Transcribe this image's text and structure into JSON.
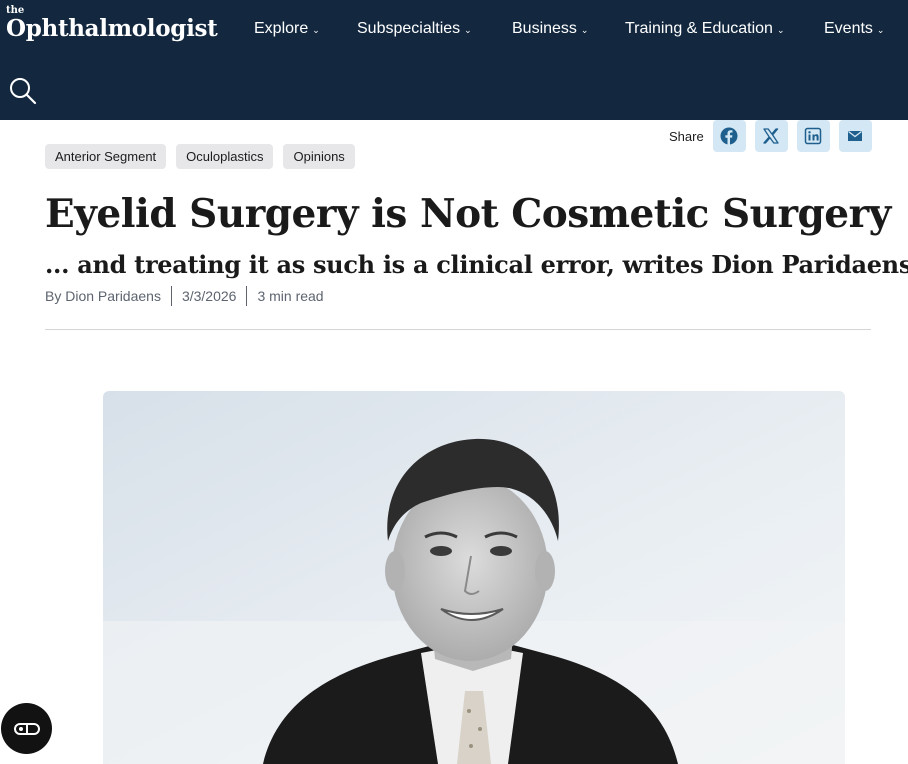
{
  "brand": {
    "small": "the",
    "name": "Ophthalmologist"
  },
  "nav": [
    {
      "label": "Explore"
    },
    {
      "label": "Subspecialties"
    },
    {
      "label": "Business"
    },
    {
      "label": "Training & Education"
    },
    {
      "label": "Events"
    }
  ],
  "search": {
    "icon": "search-icon"
  },
  "tags": [
    "Anterior Segment",
    "Oculoplastics",
    "Opinions"
  ],
  "share": {
    "label": "Share",
    "buttons": [
      "facebook-icon",
      "x-icon",
      "linkedin-icon",
      "email-icon"
    ]
  },
  "article": {
    "title": "Eyelid Surgery is Not Cosmetic Surgery",
    "subtitle": "... and treating it as such is a clinical error, writes Dion Paridaens",
    "author": "By Dion Paridaens",
    "date": "3/3/2026",
    "read_time": "3 min read"
  },
  "colors": {
    "header_bg": "#13283f",
    "tag_bg": "#e7e7ea",
    "share_btn_bg": "#d3e7f4",
    "share_icon": "#1e5f8e"
  },
  "accessibility_button": {
    "icon": "accessibility-icon"
  }
}
